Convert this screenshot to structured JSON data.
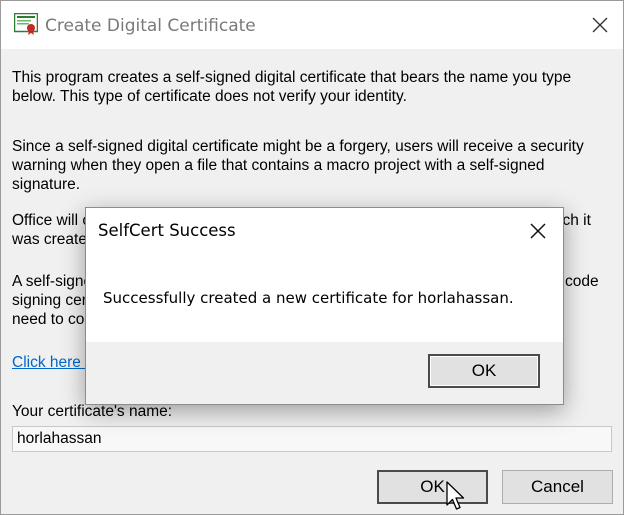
{
  "window": {
    "title": "Create Digital Certificate",
    "icon": "certificate-icon",
    "close_icon": "close-icon"
  },
  "main": {
    "para1_line1": "This program creates a self-signed digital certificate that bears the name you type",
    "para1_line2": "below. This type of certificate does not verify your identity.",
    "para2_line1": "Since a self-signed digital certificate might be a forgery, users will receive a security",
    "para2_line2": "warning when they open a file that contains a macro project with a self-signed",
    "para2_line3": "signature.",
    "para3_line1_start": "Office will c",
    "para3_line1_end": "ich it",
    "para3_line2": "was create",
    "para4_line1_start": "A self-signe",
    "para4_line1_end": "code",
    "para4_line2": "signing cer",
    "para4_line3": "need to co",
    "link_text": "Click here f",
    "name_label": "Your certificate's name:",
    "name_value": "horlahassan"
  },
  "buttons": {
    "ok": "OK",
    "cancel": "Cancel"
  },
  "popup": {
    "title": "SelfCert Success",
    "message": "Successfully created a new certificate for horlahassan.",
    "ok": "OK"
  },
  "colors": {
    "link": "#0066cc",
    "window_bg": "#f0f0f0",
    "button_bg": "#e1e1e1"
  }
}
